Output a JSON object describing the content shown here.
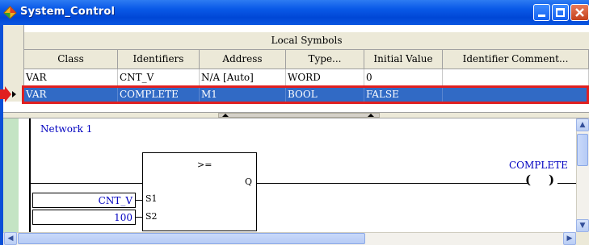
{
  "window": {
    "title": "System_Control",
    "controls": {
      "minimize": "minimize",
      "maximize": "maximize",
      "close": "close"
    }
  },
  "symbols_table": {
    "caption": "Local Symbols",
    "columns": [
      "Class",
      "Identifiers",
      "Address",
      "Type...",
      "Initial Value",
      "Identifier Comment..."
    ],
    "rows": [
      {
        "class": "VAR",
        "identifier": "CNT_V",
        "address": "N/A [Auto]",
        "type": "WORD",
        "initial_value": "0",
        "comment": ""
      },
      {
        "class": "VAR",
        "identifier": "COMPLETE",
        "address": "M1",
        "type": "BOOL",
        "initial_value": "FALSE",
        "comment": "",
        "selected": true
      }
    ]
  },
  "ladder": {
    "network_label": "Network 1",
    "block": {
      "operator": ">=",
      "output_pin": "Q",
      "inputs": [
        {
          "pin": "S1",
          "operand": "CNT_V"
        },
        {
          "pin": "S2",
          "operand": "100"
        }
      ]
    },
    "coil": {
      "name": "COMPLETE",
      "left": "(",
      "right": ")"
    }
  },
  "icons": {
    "app": "app-icon",
    "selection_marker": "red-arrow-icon",
    "row_indicator": "row-indicator-icon"
  },
  "colors": {
    "title_bar": "#0a56e0",
    "selection": "#316ac5",
    "highlight_outline": "#e02020",
    "operand_text": "#0000c0",
    "rail": "#c4e4c4"
  }
}
